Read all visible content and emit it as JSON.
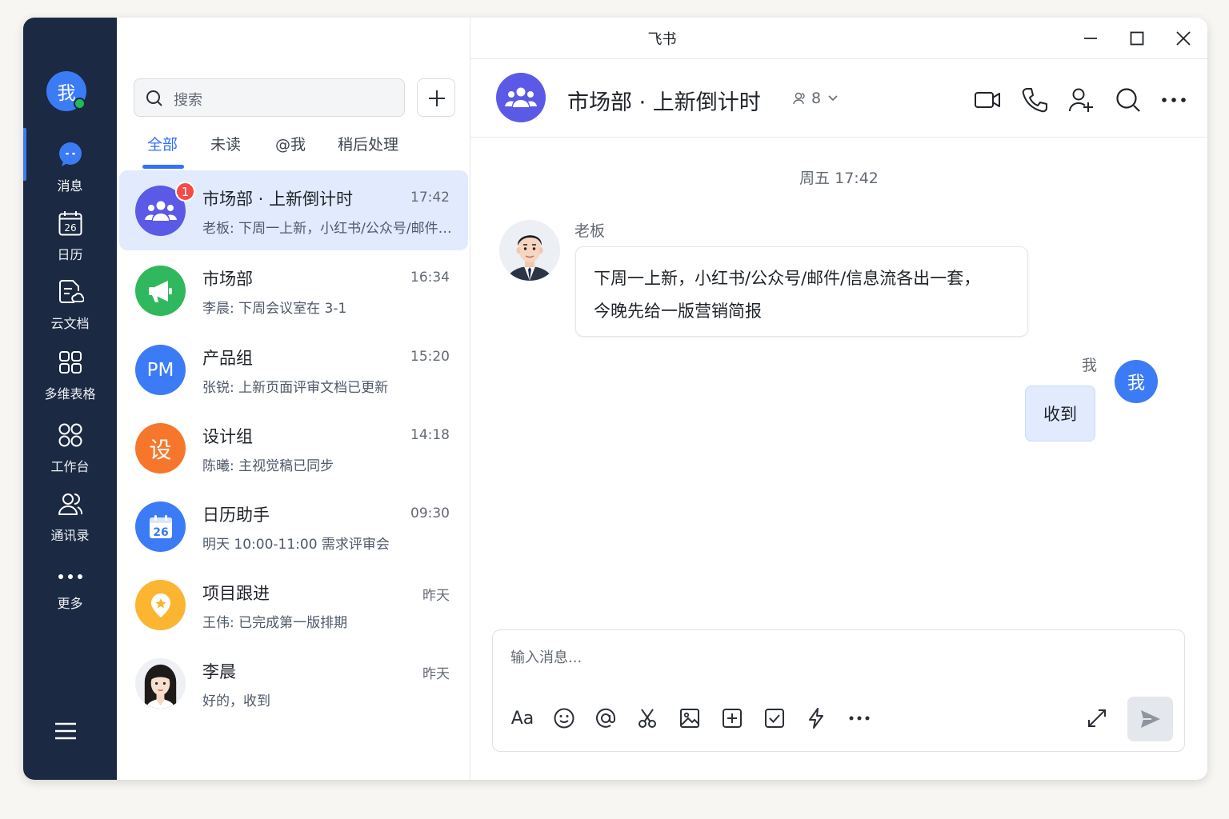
{
  "app": {
    "title": "飞书"
  },
  "rail": {
    "self_avatar": "我",
    "items": [
      {
        "label": "消息",
        "icon": "message-bubble-icon"
      },
      {
        "label": "日历",
        "icon": "calendar-icon",
        "day": "26"
      },
      {
        "label": "云文档",
        "icon": "cloud-doc-icon"
      },
      {
        "label": "多维表格",
        "icon": "base-table-icon"
      },
      {
        "label": "工作台",
        "icon": "workplace-grid-icon"
      },
      {
        "label": "通讯录",
        "icon": "contacts-icon"
      },
      {
        "label": "更多",
        "icon": "more-dots-icon"
      }
    ],
    "menu_icon": "hamburger-menu-icon"
  },
  "search": {
    "placeholder": "搜索"
  },
  "tabs": [
    "全部",
    "未读",
    "@我",
    "稍后处理"
  ],
  "chats": [
    {
      "name": "市场部 · 上新倒计时",
      "time": "17:42",
      "preview": "老板: 下周一上新，小红书/公众号/邮件/...",
      "badge": "1",
      "avatar": "group-people-icon",
      "color": "#5b5ae6"
    },
    {
      "name": "市场部",
      "time": "16:34",
      "preview": "李晨: 下周会议室在 3-1",
      "avatar": "megaphone-icon",
      "color": "#30b85e"
    },
    {
      "name": "产品组",
      "time": "15:20",
      "preview": "张锐: 上新页面评审文档已更新",
      "avatar_text": "PM",
      "color": "#3c7bf6"
    },
    {
      "name": "设计组",
      "time": "14:18",
      "preview": "陈曦: 主视觉稿已同步",
      "avatar_text": "设",
      "color": "#f6772c"
    },
    {
      "name": "日历助手",
      "time": "09:30",
      "preview": "明天 10:00-11:00 需求评审会",
      "avatar": "calendar-icon",
      "avatar_day": "26",
      "color": "#3c7bf6"
    },
    {
      "name": "项目跟进",
      "time": "昨天",
      "preview": "王伟: 已完成第一版排期",
      "avatar": "location-pin-icon",
      "color": "#fbb530"
    },
    {
      "name": "李晨",
      "time": "昨天",
      "preview": "好的，收到",
      "avatar": "woman-portrait"
    }
  ],
  "conversation": {
    "title": "市场部 · 上新倒计时",
    "member_count": "8",
    "day_stamp": "周五 17:42",
    "messages": [
      {
        "sender": "老板",
        "lines": [
          "下周一上新，小红书/公众号/邮件/信息流各出一套，",
          "今晚先给一版营销简报"
        ]
      },
      {
        "sender": "我",
        "text": "收到"
      }
    ],
    "composer_placeholder": "输入消息...",
    "composer_font_tool": "Aa"
  }
}
